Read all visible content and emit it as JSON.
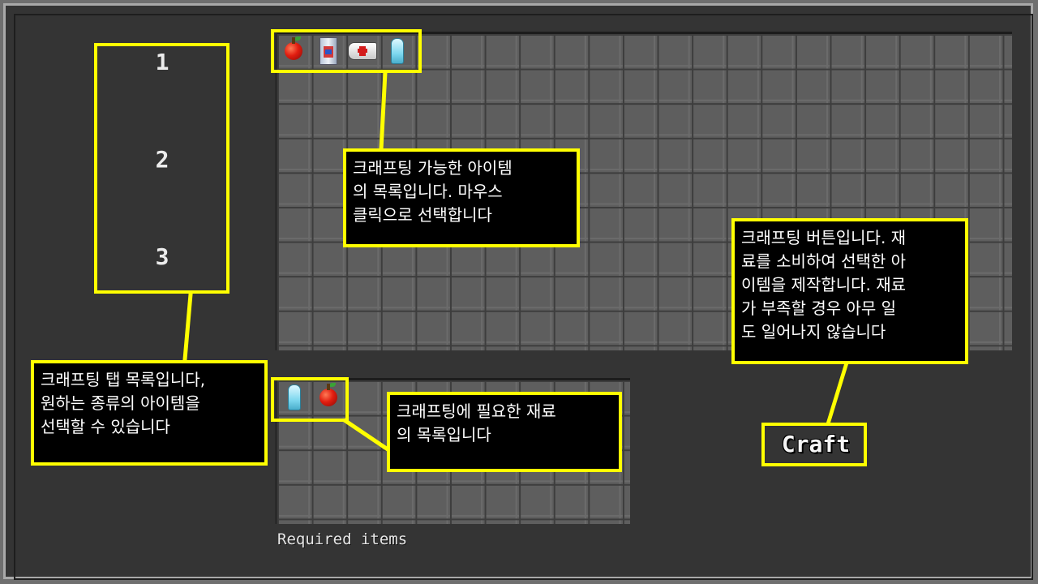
{
  "tabs": {
    "items": [
      {
        "label": "1"
      },
      {
        "label": "2"
      },
      {
        "label": "3"
      }
    ]
  },
  "craftable_items": [
    {
      "icon": "apple-icon"
    },
    {
      "icon": "can-icon"
    },
    {
      "icon": "medkit-icon"
    },
    {
      "icon": "crystal-icon"
    }
  ],
  "required_items": {
    "label": "Required items",
    "items": [
      {
        "icon": "crystal-icon"
      },
      {
        "icon": "apple-icon"
      }
    ]
  },
  "craft_button": {
    "label": "Craft"
  },
  "annotations": {
    "tabs": "크래프팅 탭 목록입니다,\n원하는 종류의 아이템을\n선택할 수 있습니다",
    "items": "크래프팅 가능한 아이템\n의 목록입니다. 마우스\n클릭으로 선택합니다",
    "materials": "크래프팅에 필요한 재료\n의 목록입니다",
    "craft": "크래프팅 버튼입니다. 재\n료를 소비하여 선택한 아\n이템을 제작합니다. 재료\n가 부족할 경우 아무 일\n도 일어나지 않습니다"
  },
  "colors": {
    "highlight": "#ffff00",
    "background": "#343434",
    "slot": "#5e5e5e"
  }
}
